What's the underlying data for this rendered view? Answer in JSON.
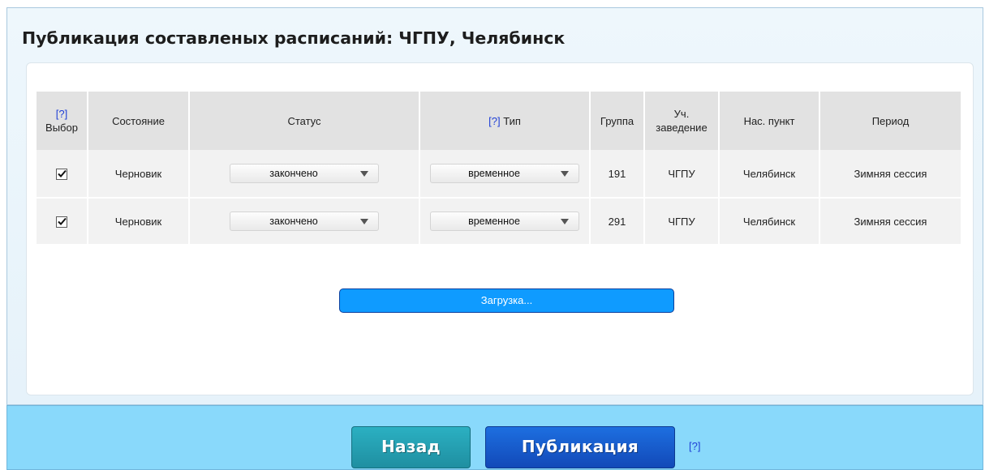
{
  "page": {
    "title": "Публикация составленых расписаний: ЧГПУ, Челябинск"
  },
  "table": {
    "headers": {
      "select_help": "[?]",
      "select": "Выбор",
      "state": "Состояние",
      "status": "Статус",
      "type_help": "[?]",
      "type": "Тип",
      "group": "Группа",
      "institution_line1": "Уч.",
      "institution_line2": "заведение",
      "city": "Нас. пункт",
      "period": "Период"
    },
    "rows": [
      {
        "checked": true,
        "state": "Черновик",
        "status": "закончено",
        "type": "временное",
        "group": "191",
        "institution": "ЧГПУ",
        "city": "Челябинск",
        "period": "Зимняя сессия"
      },
      {
        "checked": true,
        "state": "Черновик",
        "status": "закончено",
        "type": "временное",
        "group": "291",
        "institution": "ЧГПУ",
        "city": "Челябинск",
        "period": "Зимняя сессия"
      }
    ]
  },
  "loading": {
    "label": "Загрузка..."
  },
  "footer": {
    "back_label": "Назад",
    "publish_label": "Публикация",
    "help": "[?]"
  },
  "icons": {
    "checkbox": "check-icon",
    "dropdown": "triangle-down-icon"
  },
  "colors": {
    "loading_bar": "#0f9bff",
    "footer_bg": "#89d9fb",
    "back_button": "#23a0b2",
    "publish_button": "#1a5fd0",
    "help_link": "#1f3fd6"
  }
}
